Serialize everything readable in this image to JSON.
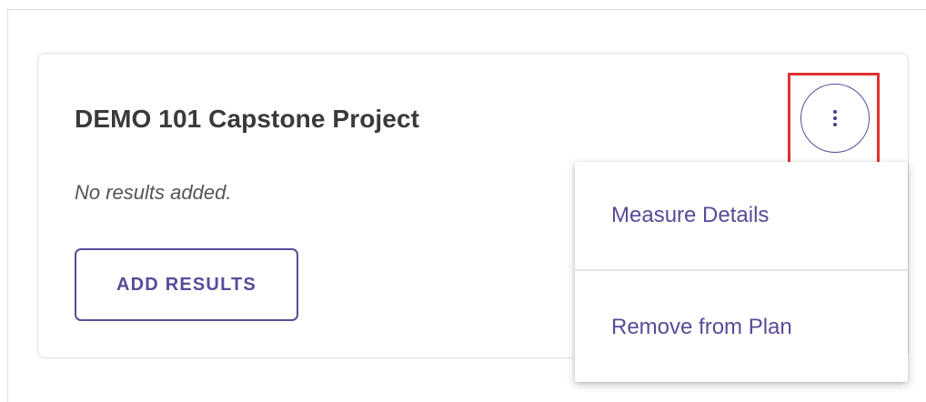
{
  "card": {
    "title": "DEMO 101 Capstone Project",
    "empty_note": "No results added.",
    "add_button_label": "ADD RESULTS"
  },
  "actions_menu": {
    "trigger_icon": "more-vertical-icon",
    "items": [
      {
        "label": "Measure Details"
      },
      {
        "label": "Remove from Plan"
      }
    ]
  },
  "colors": {
    "accent": "#5b4a99",
    "highlight": "#e03030",
    "title_text": "#3a3a3a",
    "note_text": "#555555"
  }
}
